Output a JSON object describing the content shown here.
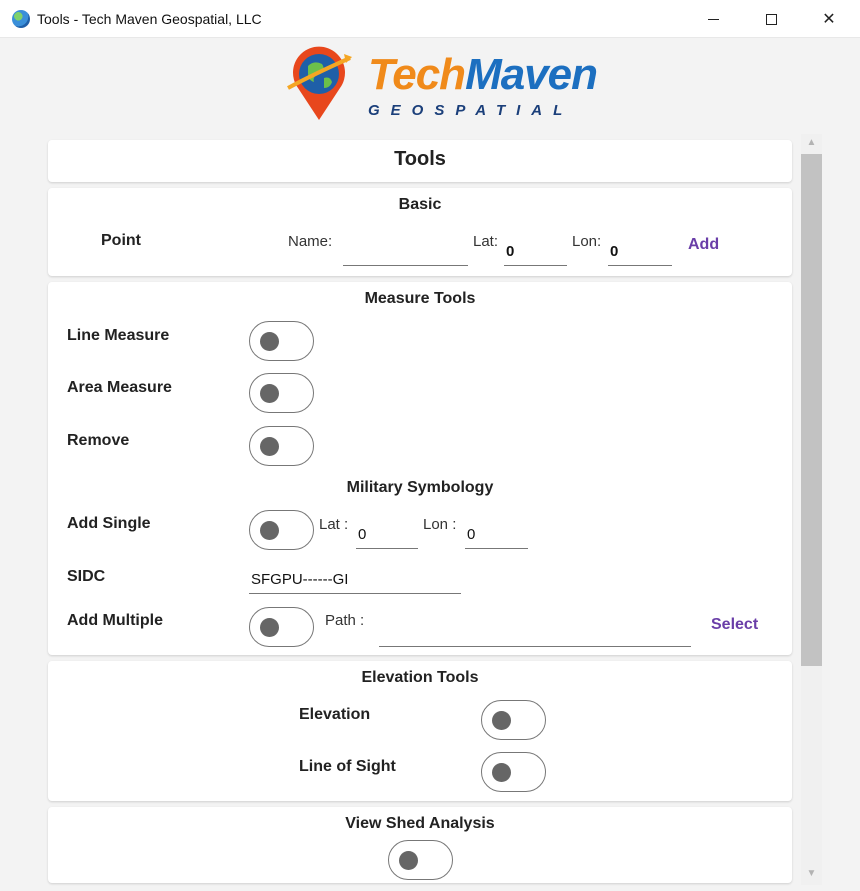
{
  "window": {
    "title": "Tools - Tech Maven Geospatial, LLC",
    "close_glyph": "✕"
  },
  "logo": {
    "word1": "Tech",
    "word2": "Maven",
    "subtitle": "GEOSPATIAL"
  },
  "tools_title": "Tools",
  "basic": {
    "heading": "Basic",
    "point_label": "Point",
    "name_label": "Name:",
    "name_value": "",
    "lat_label": "Lat:",
    "lat_value": "0",
    "lon_label": "Lon:",
    "lon_value": "0",
    "add_label": "Add"
  },
  "measure": {
    "heading": "Measure Tools",
    "line_measure": "Line Measure",
    "area_measure": "Area Measure",
    "remove": "Remove"
  },
  "military": {
    "heading": "Military Symbology",
    "add_single": "Add Single",
    "lat_label": "Lat :",
    "lat_value": "0",
    "lon_label": "Lon :",
    "lon_value": "0",
    "sidc_label": "SIDC",
    "sidc_value": "SFGPU------GI",
    "add_multiple": "Add Multiple",
    "path_label": "Path :",
    "path_value": "",
    "select_label": "Select"
  },
  "elevation": {
    "heading": "Elevation Tools",
    "elevation": "Elevation",
    "line_of_sight": "Line of Sight"
  },
  "viewshed": {
    "heading": "View Shed Analysis"
  },
  "colors": {
    "accent": "#6a3ea8",
    "logo_orange": "#f08a1a",
    "logo_blue": "#1c6fc0"
  },
  "icons": {
    "app": "globe-icon",
    "minimize": "minimize-icon",
    "maximize": "maximize-icon",
    "close": "close-icon",
    "scroll_up": "arrow-up-icon",
    "scroll_down": "arrow-down-icon"
  }
}
